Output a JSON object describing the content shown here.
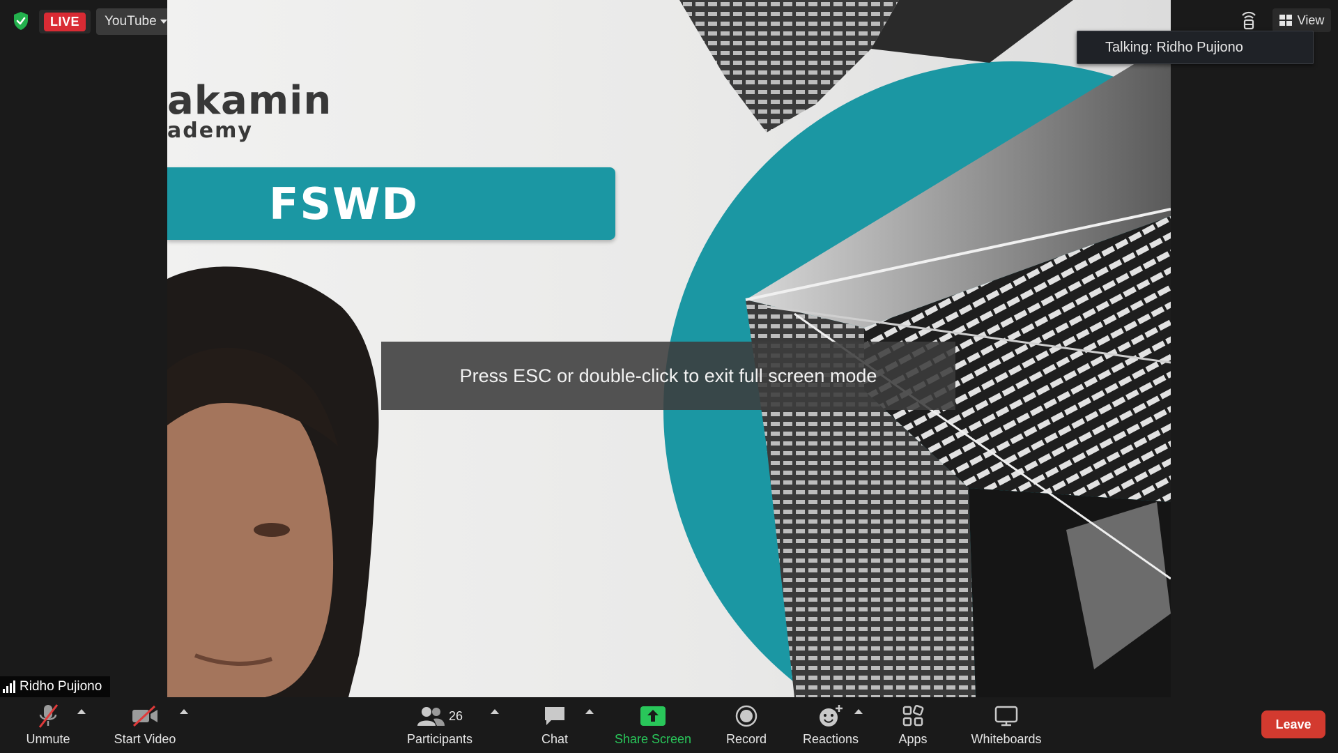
{
  "top_left": {
    "live_label": "LIVE",
    "platform_label": "YouTube"
  },
  "top_right": {
    "view_label": "View",
    "talking_label": "Talking: Ridho Pujiono"
  },
  "video": {
    "slide_logo_line1": "akamin",
    "slide_logo_line2": "ademy",
    "slide_banner": "FSWD",
    "fullscreen_hint": "Press ESC or double-click to exit full screen mode",
    "participant_name": "Ridho Pujiono"
  },
  "toolbar": {
    "unmute": "Unmute",
    "start_video": "Start Video",
    "participants": "Participants",
    "participant_count": "26",
    "chat": "Chat",
    "share_screen": "Share Screen",
    "record": "Record",
    "reactions": "Reactions",
    "apps": "Apps",
    "whiteboards": "Whiteboards",
    "leave": "Leave"
  },
  "colors": {
    "live_red": "#d92b34",
    "teal": "#1b97a3",
    "share_green": "#29c75a",
    "leave_red": "#d33a2f"
  }
}
